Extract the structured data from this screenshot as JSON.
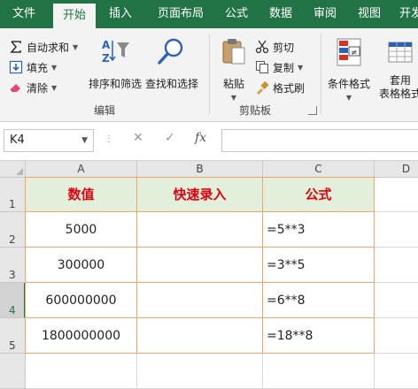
{
  "ribbon_tabs": [
    "文件",
    "开始",
    "插入",
    "页面布局",
    "公式",
    "数据",
    "审阅",
    "视图",
    "开发"
  ],
  "active_tab": "开始",
  "editing_group": {
    "label": "编辑",
    "autosum": "自动求和",
    "fill": "填充",
    "clear": "清除",
    "sort_filter": "排序和筛选",
    "find_select": "查找和选择"
  },
  "clipboard_group": {
    "label": "剪贴板",
    "paste": "粘贴",
    "cut": "剪切",
    "copy": "复制",
    "format_painter": "格式刷"
  },
  "styles_group": {
    "conditional_format": "条件格式",
    "table_format_line1": "套用",
    "table_format_line2": "表格格式"
  },
  "formula_bar": {
    "name_box": "K4",
    "cancel_symbol": "✕",
    "enter_symbol": "✓",
    "fx_symbol": "fx",
    "value": ""
  },
  "columns": [
    "A",
    "B",
    "C",
    "D"
  ],
  "rows": [
    "1",
    "2",
    "3",
    "4",
    "5"
  ],
  "selected_row": "4",
  "table": {
    "headers": [
      "数值",
      "快速录入",
      "公式"
    ],
    "rows": [
      {
        "value": "5000",
        "quick": "",
        "formula": "=5**3"
      },
      {
        "value": "300000",
        "quick": "",
        "formula": "=3**5"
      },
      {
        "value": "600000000",
        "quick": "",
        "formula": "=6**8"
      },
      {
        "value": "1800000000",
        "quick": "",
        "formula": "=18**8"
      }
    ]
  },
  "colors": {
    "ribbon_green": "#217346",
    "header_fill": "#e2efda",
    "header_text": "#e3000f",
    "table_border": "#f0a36b"
  }
}
